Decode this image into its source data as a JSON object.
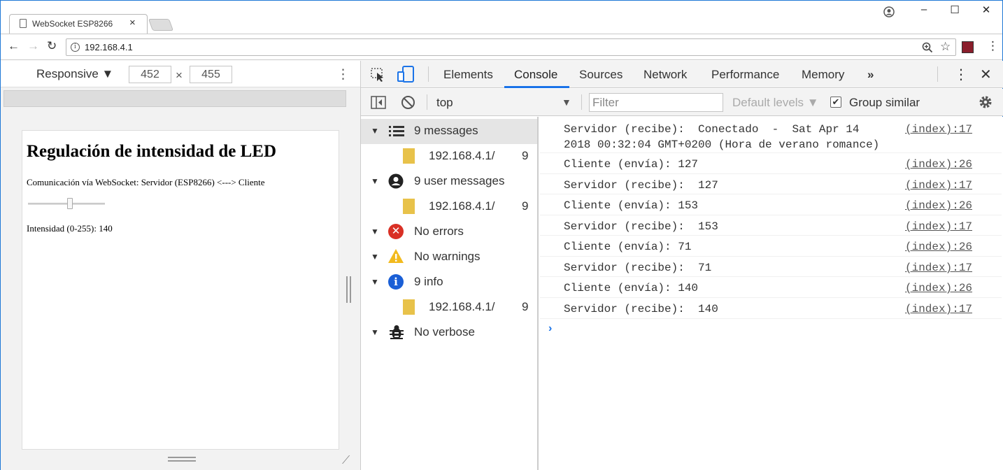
{
  "browser": {
    "tab_title": "WebSocket ESP8266",
    "tab_close": "×",
    "url": "192.168.4.1",
    "back": "←",
    "forward": "→",
    "reload": "↻",
    "menu": "⋮",
    "minimize": "–",
    "maximize": "☐",
    "close": "✕"
  },
  "device_toolbar": {
    "mode": "Responsive ▼",
    "width": "452",
    "times": "×",
    "height": "455",
    "more": "⋮"
  },
  "page": {
    "heading": "Regulación de intensidad de LED",
    "subtitle": "Comunicación vía WebSocket:  Servidor (ESP8266) <---> Cliente",
    "intensity": "Intensidad (0-255): 140",
    "slider_fraction": 0.55
  },
  "devtools": {
    "tabs": [
      "Elements",
      "Console",
      "Sources",
      "Network",
      "Performance",
      "Memory",
      "»"
    ],
    "active_tab": "Console",
    "context": "top",
    "filter_placeholder": "Filter",
    "levels": "Default levels ▼",
    "group_similar": "Group similar",
    "sidebar": [
      {
        "label": "9 messages",
        "icon": "list-icon",
        "color": "#333333"
      },
      {
        "file": "192.168.4.1/",
        "count": "9"
      },
      {
        "label": "9 user messages",
        "icon": "user-icon",
        "color": "#222222"
      },
      {
        "file": "192.168.4.1/",
        "count": "9"
      },
      {
        "label": "No errors",
        "icon": "error-icon",
        "color": "#d93025"
      },
      {
        "label": "No warnings",
        "icon": "warning-icon",
        "color": "#f2ba1e"
      },
      {
        "label": "9 info",
        "icon": "info-icon",
        "color": "#1a5fd6"
      },
      {
        "file": "192.168.4.1/",
        "count": "9"
      },
      {
        "label": "No verbose",
        "icon": "bug-icon",
        "color": "#222222"
      }
    ],
    "messages": [
      {
        "text": "Servidor (recibe):  Conectado  -  Sat Apr 14\n2018 00:32:04 GMT+0200 (Hora de verano romance)",
        "src": "(index):17"
      },
      {
        "text": "Cliente (envía): 127",
        "src": "(index):26"
      },
      {
        "text": "Servidor (recibe):  127",
        "src": "(index):17"
      },
      {
        "text": "Cliente (envía): 153",
        "src": "(index):26"
      },
      {
        "text": "Servidor (recibe):  153",
        "src": "(index):17"
      },
      {
        "text": "Cliente (envía): 71",
        "src": "(index):26"
      },
      {
        "text": "Servidor (recibe):  71",
        "src": "(index):17"
      },
      {
        "text": "Cliente (envía): 140",
        "src": "(index):26"
      },
      {
        "text": "Servidor (recibe):  140",
        "src": "(index):17"
      }
    ],
    "prompt": "›"
  }
}
